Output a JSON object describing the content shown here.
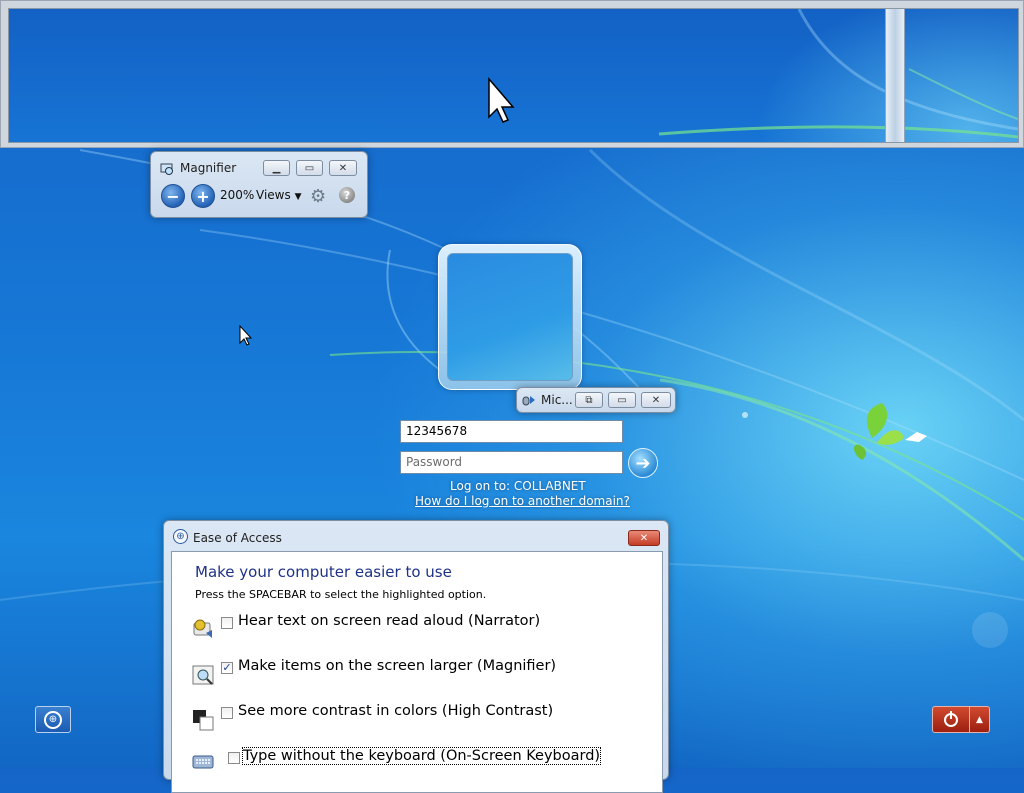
{
  "magnifier": {
    "title": "Magnifier",
    "zoom": "200%",
    "views_label": "Views",
    "icons": [
      "magnifier-app-icon",
      "zoom-out-icon",
      "zoom-in-icon",
      "settings-gear-icon",
      "help-icon"
    ]
  },
  "mic_window": {
    "title": "Mic..."
  },
  "logon": {
    "username": "12345678",
    "password_placeholder": "Password",
    "logon_to": "Log on to: COLLABNET",
    "domain_help_link": "How do I log on to another domain?"
  },
  "ease_of_access": {
    "title": "Ease of Access",
    "heading": "Make your computer easier to use",
    "instruction": "Press the SPACEBAR to select the highlighted option.",
    "options": [
      {
        "label": "Hear text on screen read aloud (Narrator)",
        "checked": false,
        "icon": "narrator-icon"
      },
      {
        "label": "Make items on the screen larger (Magnifier)",
        "checked": true,
        "icon": "magnifier-icon"
      },
      {
        "label": "See more contrast in colors (High Contrast)",
        "checked": false,
        "icon": "high-contrast-icon"
      },
      {
        "label": "Type without the keyboard (On-Screen Keyboard)",
        "checked": false,
        "icon": "keyboard-icon"
      }
    ]
  },
  "colors": {
    "desktop_blue": "#1778d6",
    "heading_blue": "#1e3287",
    "power_red": "#c43c26"
  }
}
